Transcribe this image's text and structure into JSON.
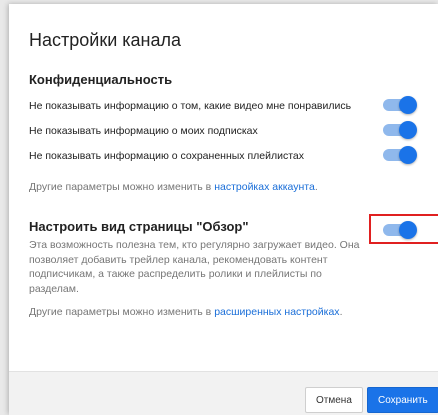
{
  "dialog": {
    "title": "Настройки канала"
  },
  "privacy": {
    "heading": "Конфиденциальность",
    "rows": [
      {
        "label": "Не показывать информацию о том, какие видео мне понравились",
        "enabled": true
      },
      {
        "label": "Не показывать информацию о моих подписках",
        "enabled": true
      },
      {
        "label": "Не показывать информацию о сохраненных плейлистах",
        "enabled": true
      }
    ],
    "note_text": "Другие параметры можно изменить в ",
    "note_link": "настройках аккаунта",
    "note_end": "."
  },
  "browse": {
    "heading": "Настроить вид страницы \"Обзор\"",
    "enabled": true,
    "description": "Эта возможность полезна тем, кто регулярно загружает видео. Она позволяет добавить трейлер канала, рекомендовать контент подписчикам, а также распределить ролики и плейлисты по разделам.",
    "note_text": "Другие параметры можно изменить в ",
    "note_link": "расширенных настройках",
    "note_end": "."
  },
  "footer": {
    "cancel_label": "Отмена",
    "save_label": "Сохранить"
  },
  "colors": {
    "accent": "#1a73e8",
    "track": "#8fb8ec",
    "highlight": "#e02020",
    "link": "#1a6ed8"
  }
}
